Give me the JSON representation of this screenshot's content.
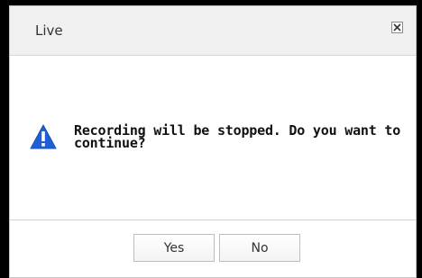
{
  "dialog": {
    "title": "Live",
    "message": "Recording will be stopped. Do you want to continue?",
    "buttons": {
      "yes": "Yes",
      "no": "No"
    },
    "icons": {
      "close": "close-icon",
      "warning": "warning-icon"
    },
    "colors": {
      "warning_fill": "#1e5fd6",
      "titlebar_bg": "#f0f0f0"
    }
  }
}
